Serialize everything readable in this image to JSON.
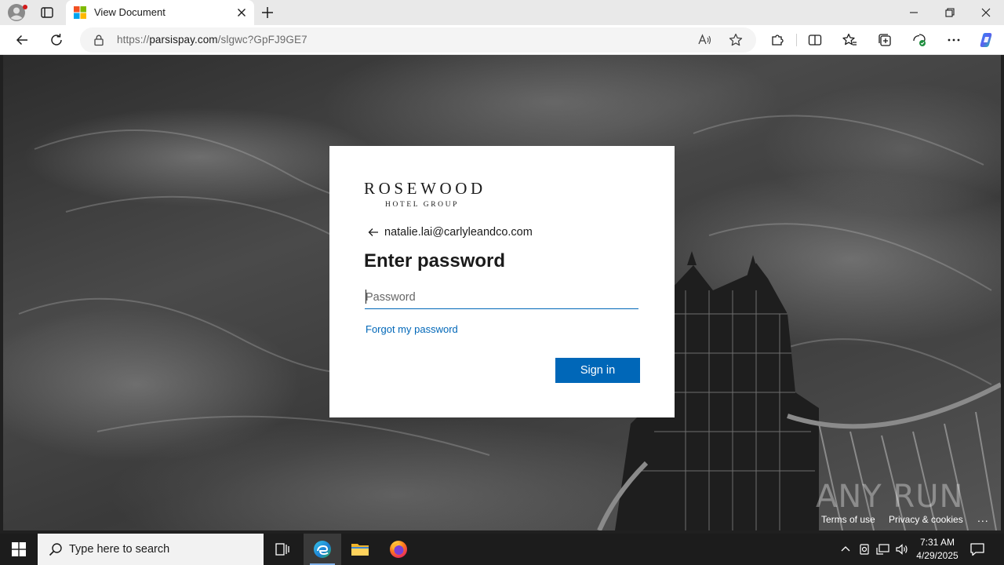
{
  "browser": {
    "tab_title": "View Document",
    "url_prefix": "https://",
    "url_host": "parsispay.com",
    "url_path": "/slgwc?GpFJ9GE7"
  },
  "page": {
    "logo_main": "ROSEWOOD",
    "logo_sub": "HOTEL GROUP",
    "identity": "natalie.lai@carlyleandco.com",
    "heading": "Enter password",
    "password_placeholder": "Password",
    "forgot_link": "Forgot my password",
    "signin_label": "Sign in",
    "footer_terms": "Terms of use",
    "footer_privacy": "Privacy & cookies",
    "footer_more": "...",
    "watermark": "ANY RUN"
  },
  "taskbar": {
    "search_placeholder": "Type here to search",
    "time": "7:31 AM",
    "date": "4/29/2025"
  },
  "colors": {
    "accent": "#0067b8",
    "taskbar": "#1c1c1c"
  }
}
